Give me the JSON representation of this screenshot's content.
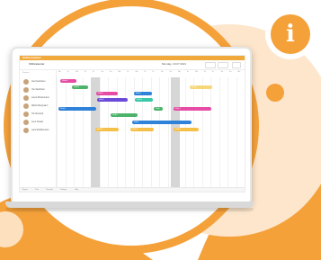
{
  "app": {
    "name": "Shiftscheduler",
    "title": "Shiftcalender",
    "date_range": "Monday, 19.07.2021",
    "sidebar_label": "Persons"
  },
  "people": [
    {
      "name": "Jan Kaufmann"
    },
    {
      "name": "Ute Sandman"
    },
    {
      "name": "Laura Rindermann"
    },
    {
      "name": "Martin Bergmann"
    },
    {
      "name": "Tim Reichelt"
    },
    {
      "name": "Jens Friedel"
    },
    {
      "name": "Lara Schiffermann"
    }
  ],
  "days": [
    "Mo",
    "Tu",
    "We",
    "Th",
    "Fr",
    "Sa",
    "Su",
    "Mo",
    "Tu",
    "We",
    "Th",
    "Fr",
    "Sa",
    "Su",
    "Mo",
    "Tu",
    "We",
    "Th",
    "Fr",
    "Sa",
    "Su",
    "Mo"
  ],
  "bars": [
    {
      "label": "Shift A",
      "color": "#e64ba6"
    },
    {
      "label": "Shift B",
      "color": "#4db36b"
    },
    {
      "label": "Shift C",
      "color": "#e64ba6"
    },
    {
      "label": "Shift D",
      "color": "#2f82d9"
    },
    {
      "label": "Shift E",
      "color": "#f5d77a"
    },
    {
      "label": "Shift F",
      "color": "#6a4bd9"
    },
    {
      "label": "Shift G",
      "color": "#3ac8a8"
    },
    {
      "label": "Shift H",
      "color": "#2f82d9"
    },
    {
      "label": "Shift I",
      "color": "#4db36b"
    },
    {
      "label": "Shift J",
      "color": "#e64ba6"
    },
    {
      "label": "Shift K",
      "color": "#4db36b"
    },
    {
      "label": "Shift L",
      "color": "#2f82d9"
    },
    {
      "label": "Shift M",
      "color": "#f5c04a"
    },
    {
      "label": "Shift N",
      "color": "#f5c04a"
    },
    {
      "label": "Shift O",
      "color": "#f5c04a"
    }
  ],
  "footer": {
    "items": [
      "Export",
      "Print",
      "Template",
      "Settings",
      "Help"
    ]
  },
  "colors": {
    "orange": "#f5a13a",
    "orange_light": "#fbd09a"
  }
}
